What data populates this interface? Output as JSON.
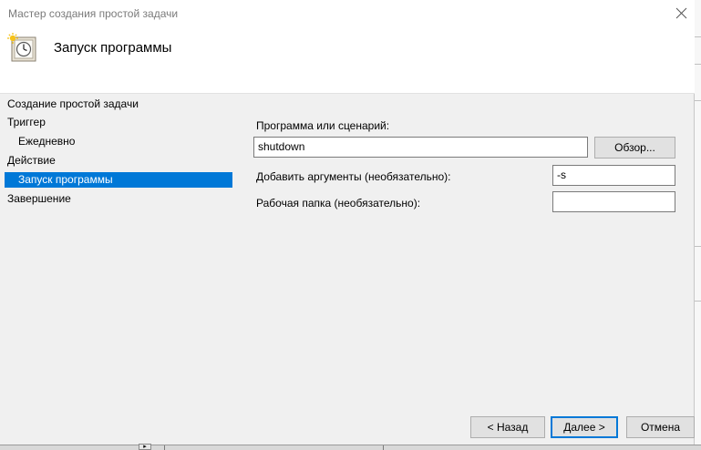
{
  "window": {
    "title": "Мастер создания простой задачи"
  },
  "header": {
    "title": "Запуск программы",
    "icon": "task-scheduler-clock-icon"
  },
  "nav": {
    "items": [
      {
        "label": "Создание простой задачи",
        "level": 0,
        "selected": false
      },
      {
        "label": "Триггер",
        "level": 0,
        "selected": false
      },
      {
        "label": "Ежедневно",
        "level": 1,
        "selected": false
      },
      {
        "label": "Действие",
        "level": 0,
        "selected": false
      },
      {
        "label": "Запуск программы",
        "level": 1,
        "selected": true
      },
      {
        "label": "Завершение",
        "level": 0,
        "selected": false
      }
    ]
  },
  "form": {
    "program_label": "Программа или сценарий:",
    "program_value": "shutdown",
    "browse_label": "Обзор...",
    "args_label": "Добавить аргументы (необязательно):",
    "args_value": "-s",
    "workdir_label": "Рабочая папка (необязательно):",
    "workdir_value": ""
  },
  "footer": {
    "back_label": "< Назад",
    "next_label": "Далее >",
    "cancel_label": "Отмена"
  },
  "colors": {
    "selection": "#0078d7",
    "window_bg": "#f0f0f0",
    "header_bg": "#ffffff"
  }
}
